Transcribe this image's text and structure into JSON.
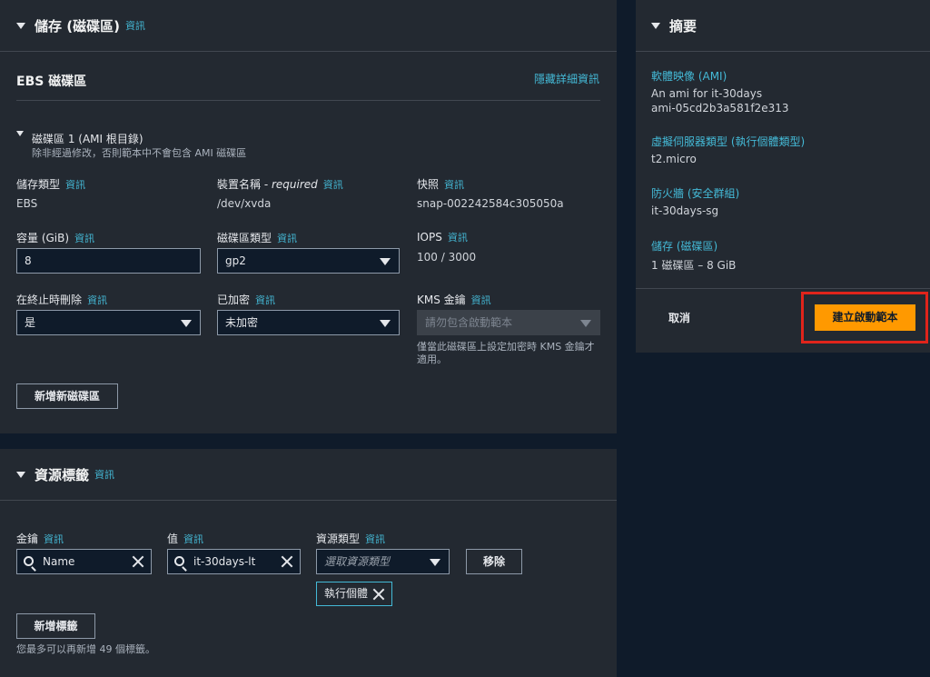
{
  "storage": {
    "title": "儲存 (磁碟區)",
    "info": "資訊",
    "ebs_title": "EBS 磁碟區",
    "hide_details": "隱藏詳細資訊",
    "volume_heading": "磁碟區 1 (AMI 根目錄)",
    "volume_note": "除非經過修改，否則範本中不會包含 AMI 磁碟區",
    "storage_type_label": "儲存類型",
    "storage_type_value": "EBS",
    "device_name_label": "裝置名稱 - ",
    "device_name_required": "required",
    "device_name_value": "/dev/xvda",
    "snapshot_label": "快照",
    "snapshot_value": "snap-002242584c305050a",
    "size_label": "容量 (GiB)",
    "size_value": "8",
    "volume_type_label": "磁碟區類型",
    "volume_type_value": "gp2",
    "iops_label": "IOPS",
    "iops_value": "100 / 3000",
    "delete_on_term_label": "在終止時刪除",
    "delete_on_term_value": "是",
    "encrypted_label": "已加密",
    "encrypted_value": "未加密",
    "kms_label": "KMS 金鑰",
    "kms_placeholder": "請勿包含啟動範本",
    "kms_note_1": "僅當此磁碟區上設定加密時 KMS 金鑰才",
    "kms_note_2": "適用。",
    "add_volume": "新增新磁碟區"
  },
  "tags": {
    "title": "資源標籤",
    "info": "資訊",
    "key_label": "金鑰",
    "key_value": "Name",
    "value_label": "值",
    "value_value": "it-30days-lt",
    "resource_type_label": "資源類型",
    "resource_type_placeholder": "選取資源類型",
    "remove": "移除",
    "chip": "執行個體",
    "add_tag": "新增標籤",
    "limit_note": "您最多可以再新增 49 個標籤。"
  },
  "summary": {
    "title": "摘要",
    "ami_label": "軟體映像 (AMI)",
    "ami_name": "An ami for it-30days",
    "ami_id": "ami-05cd2b3a581f2e313",
    "instance_type_label": "虛擬伺服器類型 (執行個體類型)",
    "instance_type_value": "t2.micro",
    "firewall_label": "防火牆 (安全群組)",
    "firewall_value": "it-30days-sg",
    "storage_label": "儲存 (磁碟區)",
    "storage_value": "1 磁碟區 – 8 GiB",
    "cancel": "取消",
    "create": "建立啟動範本"
  },
  "colors": {
    "accent_link": "#44b9d6",
    "primary_button": "#ff9900",
    "highlight_box": "#e0241b",
    "panel_bg": "#232931",
    "page_bg": "#0f1b2a"
  }
}
